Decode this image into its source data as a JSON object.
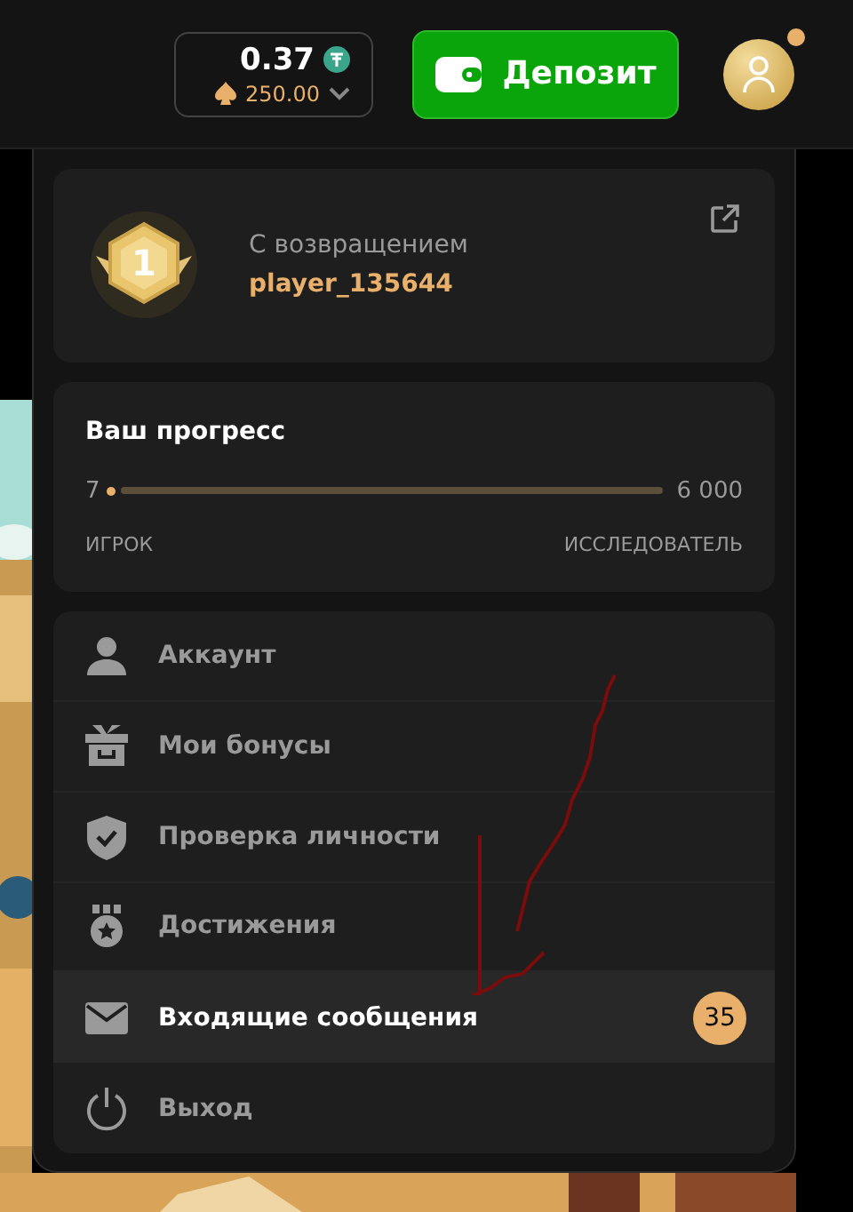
{
  "header": {
    "balance": "0.37",
    "bonus_balance": "250.00",
    "deposit_button": "Депозит",
    "notification_dot": true
  },
  "profile": {
    "greeting": "С возвращением",
    "username": "player_135644",
    "level_badge": "1"
  },
  "progress": {
    "title": "Ваш прогресс",
    "start_value": "7",
    "end_value": "6 000",
    "level": 0.001,
    "start_rank": "ИГРОК",
    "end_rank": "ИССЛЕДОВАТЕЛЬ"
  },
  "menu": [
    {
      "kind": "account",
      "label": "Аккаунт",
      "selected": false
    },
    {
      "kind": "bonus",
      "label": "Мои бонусы",
      "selected": false
    },
    {
      "kind": "verify",
      "label": "Проверка личности",
      "selected": false
    },
    {
      "kind": "achievements",
      "label": "Достижения",
      "selected": false
    },
    {
      "kind": "inbox",
      "label": "Входящие сообщения",
      "selected": true,
      "badge": "35"
    },
    {
      "kind": "logout",
      "label": "Выход",
      "selected": false
    }
  ]
}
